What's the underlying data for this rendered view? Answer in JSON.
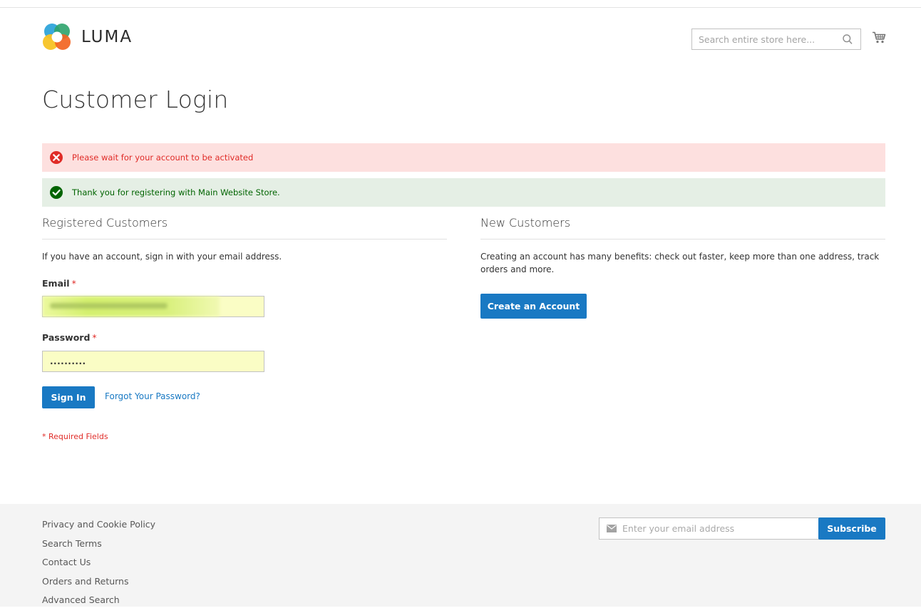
{
  "header": {
    "logo_text": "LUMA",
    "search_placeholder": "Search entire store here..."
  },
  "page_title": "Customer Login",
  "messages": {
    "error": "Please wait for your account to be activated",
    "success": "Thank you for registering with Main Website Store."
  },
  "registered": {
    "title": "Registered Customers",
    "intro": "If you have an account, sign in with your email address.",
    "email_label": "Email",
    "password_label": "Password",
    "required_marker": "*",
    "password_value": "..........",
    "sign_in_label": "Sign In",
    "forgot_label": "Forgot Your Password?",
    "required_note": "* Required Fields"
  },
  "new_customers": {
    "title": "New Customers",
    "intro": "Creating an account has many benefits: check out faster, keep more than one address, track orders and more.",
    "create_label": "Create an Account"
  },
  "footer": {
    "links": [
      "Privacy and Cookie Policy",
      "Search Terms",
      "Contact Us",
      "Orders and Returns",
      "Advanced Search"
    ],
    "newsletter_placeholder": "Enter your email address",
    "subscribe_label": "Subscribe"
  },
  "colors": {
    "primary": "#1979c3",
    "error_text": "#e02b27",
    "error_bg": "#fde0df",
    "success_text": "#006400",
    "success_bg": "#e5efe5",
    "autofill_bg": "#fafdc5",
    "footer_bg": "#f4f4f4"
  }
}
